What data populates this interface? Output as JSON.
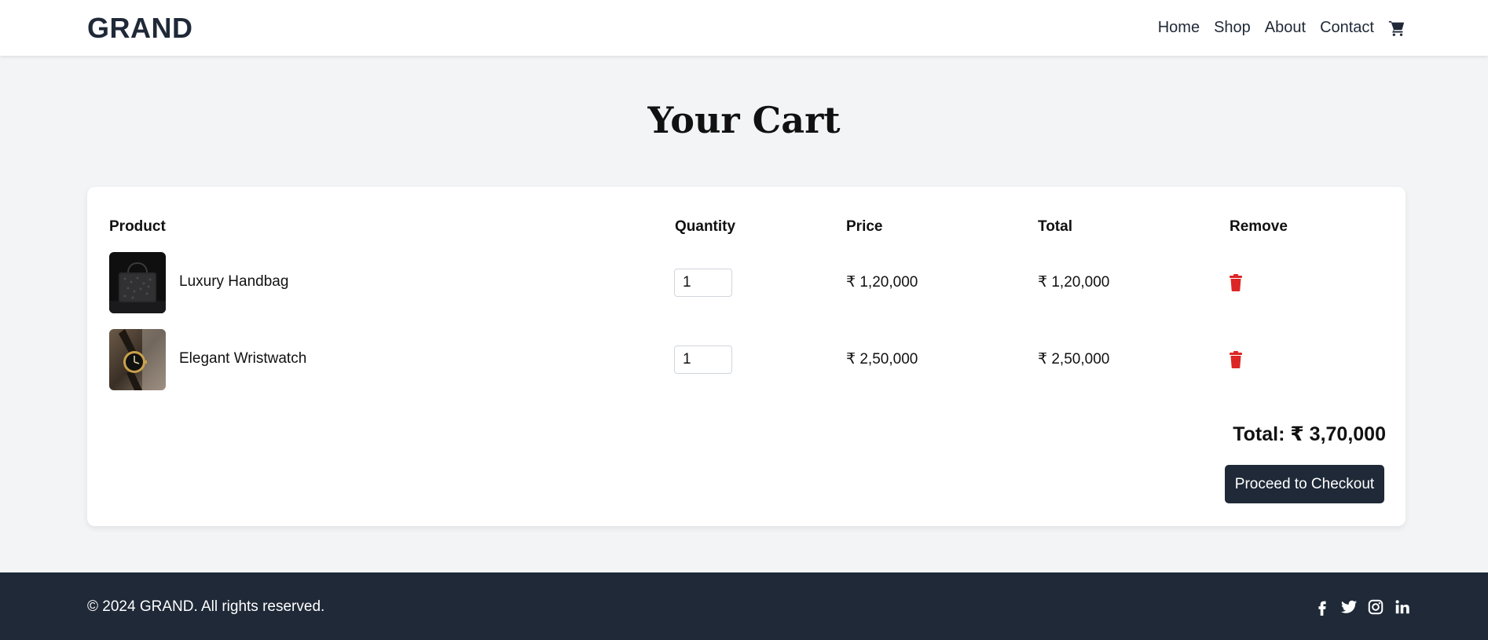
{
  "brand": {
    "logo": "GRAND"
  },
  "nav": {
    "items": [
      "Home",
      "Shop",
      "About",
      "Contact"
    ],
    "cart_icon": "shopping-cart-icon"
  },
  "page": {
    "title": "Your Cart"
  },
  "cart": {
    "headers": {
      "product": "Product",
      "quantity": "Quantity",
      "price": "Price",
      "total": "Total",
      "remove": "Remove"
    },
    "items": [
      {
        "name": "Luxury Handbag",
        "quantity": "1",
        "price": "₹ 1,20,000",
        "total": "₹ 1,20,000",
        "image": "black-handbag-photo",
        "remove_icon": "trash-icon"
      },
      {
        "name": "Elegant Wristwatch",
        "quantity": "1",
        "price": "₹ 2,50,000",
        "total": "₹ 2,50,000",
        "image": "gold-wristwatch-photo",
        "remove_icon": "trash-icon"
      }
    ],
    "grand_total": "Total: ₹ 3,70,000",
    "checkout_label": "Proceed to Checkout"
  },
  "footer": {
    "copyright": "© 2024 GRAND. All rights reserved.",
    "socials": [
      "facebook-icon",
      "twitter-icon",
      "instagram-icon",
      "linkedin-icon"
    ]
  },
  "colors": {
    "primary_dark": "#1f2937",
    "background": "#f3f4f6",
    "danger": "#dc2626"
  }
}
